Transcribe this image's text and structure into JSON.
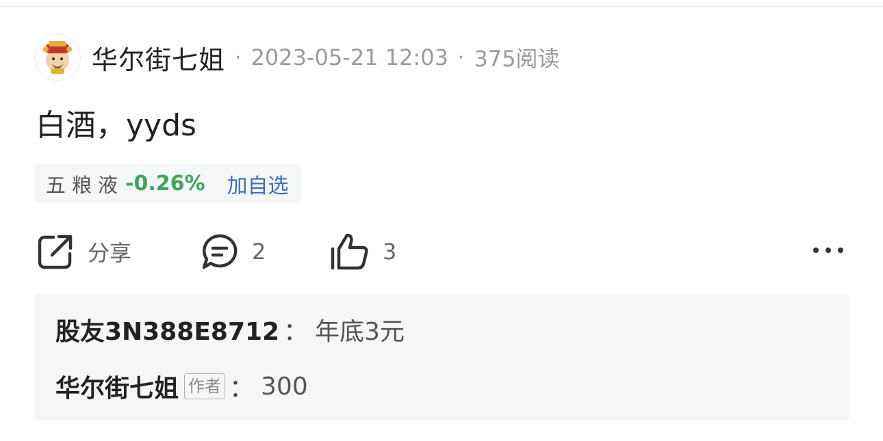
{
  "post": {
    "author": "华尔街七姐",
    "separator": "·",
    "datetime": "2023-05-21 12:03",
    "reads": "375阅读",
    "content": "白酒，yyds",
    "avatar_icon": "avatar-icon"
  },
  "stock": {
    "name": "五粮液",
    "change": "-0.26%",
    "change_color": "#3aa65a",
    "add_label": "加自选",
    "add_color": "#3a6fb8"
  },
  "actions": {
    "share_label": "分享",
    "comment_count": "2",
    "like_count": "3",
    "share_icon": "share-icon",
    "comment_icon": "comment-icon",
    "like_icon": "thumbs-up-icon",
    "more_icon": "more-icon"
  },
  "comments": [
    {
      "user": "股友3N388E8712",
      "separator": "：",
      "text": "年底3元"
    },
    {
      "user": "华尔街七姐",
      "badge": "作者",
      "separator": "：",
      "text": "300"
    }
  ]
}
